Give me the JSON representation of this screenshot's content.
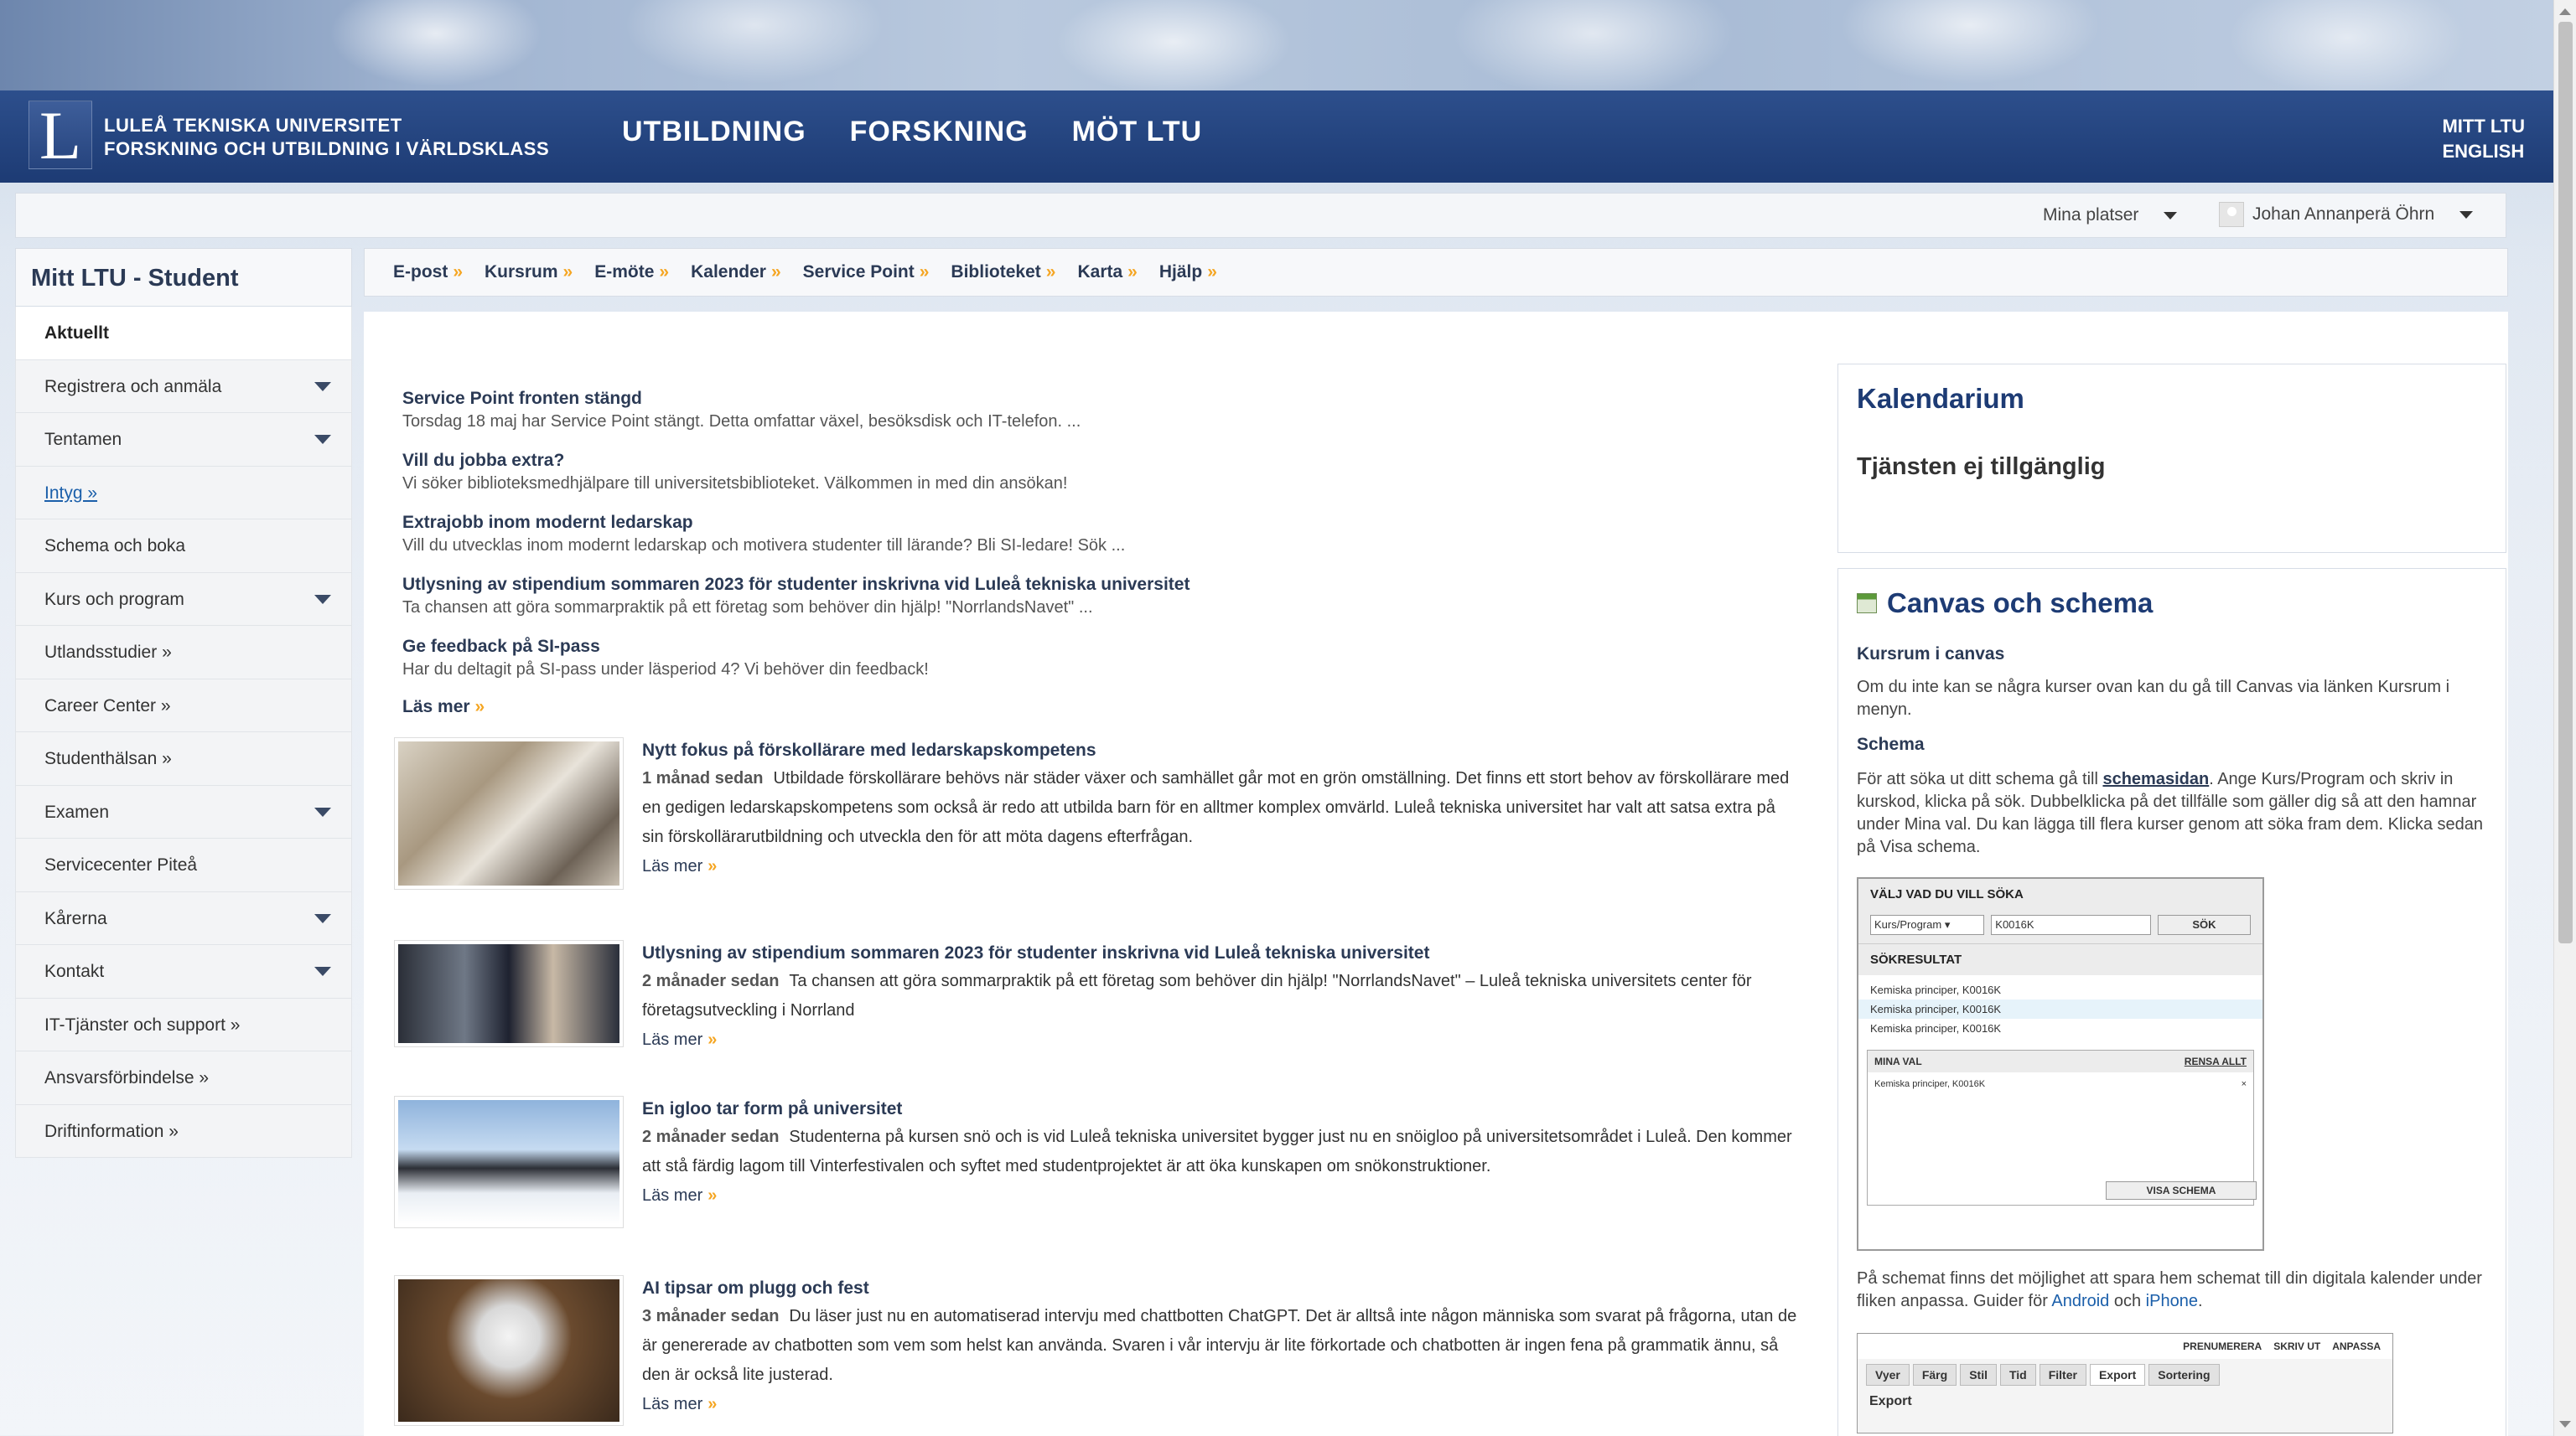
{
  "header": {
    "logo_letter": "L",
    "logo_line1": "LULEÅ TEKNISKA UNIVERSITET",
    "logo_line2": "FORSKNING OCH UTBILDNING I VÄRLDSKLASS",
    "nav": [
      "UTBILDNING",
      "FORSKNING",
      "MÖT LTU"
    ],
    "top_links": [
      "MITT LTU",
      "ENGLISH"
    ]
  },
  "userbar": {
    "places": "Mina platser",
    "user": "Johan Annanperä Öhrn"
  },
  "sidebar": {
    "title": "Mitt LTU - Student",
    "items": [
      {
        "label": "Aktuellt"
      },
      {
        "label": "Registrera och anmäla"
      },
      {
        "label": "Tentamen"
      },
      {
        "label": "Intyg »"
      },
      {
        "label": "Schema och boka"
      },
      {
        "label": "Kurs och program"
      },
      {
        "label": "Utlandsstudier »"
      },
      {
        "label": "Career Center »"
      },
      {
        "label": "Studenthälsan »"
      },
      {
        "label": "Examen"
      },
      {
        "label": "Servicecenter Piteå"
      },
      {
        "label": "Kårerna"
      },
      {
        "label": "Kontakt"
      },
      {
        "label": "IT-Tjänster och support »"
      },
      {
        "label": "Ansvarsförbindelse »"
      },
      {
        "label": "Driftinformation »"
      }
    ]
  },
  "quicklinks": [
    "E-post",
    "Kursrum",
    "E-möte",
    "Kalender",
    "Service Point",
    "Biblioteket",
    "Karta",
    "Hjälp"
  ],
  "quicklink_suffix": "»",
  "news": [
    {
      "title": "Service Point fronten stängd",
      "desc": "Torsdag 18 maj har Service Point stängt. Detta omfattar växel, besöksdisk och IT-telefon. ..."
    },
    {
      "title": "Vill du jobba extra?",
      "desc": "Vi söker biblioteksmedhjälpare till universitetsbiblioteket. Välkommen in med din ansökan!"
    },
    {
      "title": "Extrajobb inom modernt ledarskap",
      "desc": "Vill du utvecklas inom modernt ledarskap och motivera studenter till lärande? Bli SI-ledare! Sök ..."
    },
    {
      "title": "Utlysning av stipendium sommaren 2023 för studenter inskrivna vid Luleå tekniska universitet",
      "desc": "Ta chansen att göra sommarpraktik på ett företag som behöver din hjälp! \"NorrlandsNavet\" ..."
    },
    {
      "title": "Ge feedback på SI-pass",
      "desc": "Har du deltagit på SI-pass under läsperiod 4? Vi behöver din feedback!"
    }
  ],
  "news_more": "Läs mer",
  "articles": [
    {
      "title": "Nytt fokus på förskollärare med ledarskapskompetens",
      "age": "1 månad sedan",
      "text": "Utbildade förskollärare behövs när städer växer och samhället går mot en grön omställning. Det finns ett stort behov av förskollärare med en gedigen ledarskapskompetens som också är redo att utbilda barn för en alltmer komplex omvärld. Luleå tekniska universitet har valt att satsa extra på sin förskollärarutbildning och utveckla den för att möta dagens efterfrågan.",
      "more": "Läs mer"
    },
    {
      "title": "Utlysning av stipendium sommaren 2023 för studenter inskrivna vid Luleå tekniska universitet",
      "age": "2 månader sedan",
      "text": "Ta chansen att göra sommarpraktik på ett företag som behöver din hjälp! \"NorrlandsNavet\" – Luleå tekniska universitets center för företagsutveckling i Norrland",
      "more": "Läs mer"
    },
    {
      "title": "En igloo tar form på universitet",
      "age": "2 månader sedan",
      "text": "Studenterna på kursen snö och is vid Luleå tekniska universitet bygger just nu en snöigloo på universitetsområdet i Luleå. Den kommer att stå färdig lagom till Vinterfestivalen och syftet med studentprojektet är att öka kunskapen om snökonstruktioner.",
      "more": "Läs mer"
    },
    {
      "title": "AI tipsar om plugg och fest",
      "age": "3 månader sedan",
      "text": "Du läser just nu en automatiserad intervju med chattbotten ChatGPT. Det är alltså inte någon människa som svarat på frågorna, utan de är genererade av chatbotten som vem som helst kan använda. Svaren i vår intervju är lite förkortade och chatbotten är ingen fena på grammatik ännu, så den är också lite justerad.",
      "more": "Läs mer"
    }
  ],
  "kalendarium": {
    "title": "Kalendarium",
    "message": "Tjänsten ej tillgänglig"
  },
  "canvas": {
    "title": "Canvas och schema",
    "kursrum_heading": "Kursrum i canvas",
    "kursrum_text": "Om du inte kan se några kurser ovan kan du gå till Canvas via länken Kursrum i menyn.",
    "schema_heading": "Schema",
    "schema_text_1": "För att söka ut ditt schema gå till",
    "schema_link": "schemasidan",
    "schema_text_2": ". Ange Kurs/Program och skriv in kurskod, klicka på sök. Dubbelklicka på det tillfälle som gäller dig så att den hamnar under Mina val. Du kan lägga till flera kurser genom att söka fram dem. Klicka sedan på Visa schema.",
    "export_text_1": "På schemat finns det möjlighet att spara hem schemat till din digitala kalender under fliken anpassa. Guider för",
    "export_link_android": "Android",
    "export_text_and": "och",
    "export_link_iphone": "iPhone",
    "export_text_end": "."
  },
  "schema_shot": {
    "heading": "VÄLJ VAD DU VILL SÖKA",
    "select_value": "Kurs/Program",
    "input_value": "K0016K",
    "button": "SÖK",
    "results_heading": "SÖKRESULTAT",
    "results": [
      "Kemiska principer, K0016K",
      "Kemiska principer, K0016K",
      "Kemiska principer, K0016K"
    ],
    "mina_val": "MINA VAL",
    "rensa": "RENSA ALLT",
    "chosen": "Kemiska principer, K0016K",
    "visa": "VISA SCHEMA"
  },
  "export_shot": {
    "top": [
      "PRENUMERERA",
      "SKRIV UT",
      "ANPASSA"
    ],
    "tabs": [
      "Vyer",
      "Färg",
      "Stil",
      "Tid",
      "Filter",
      "Export",
      "Sortering"
    ],
    "label": "Export"
  }
}
